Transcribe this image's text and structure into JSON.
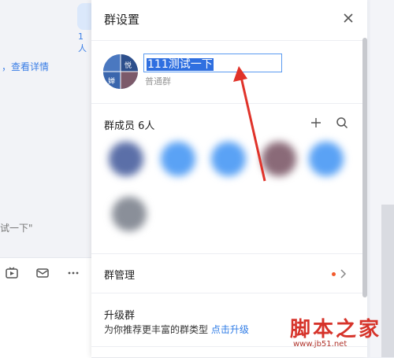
{
  "background": {
    "member_count_prefix": "1人",
    "detail_link": "，查看详情",
    "quoted_text": "试一下\""
  },
  "panel": {
    "title": "群设置",
    "group_name": "111测试一下",
    "group_type": "普通群",
    "members_label": "群成员 6人",
    "manage_label": "群管理",
    "upgrade_label": "升级群",
    "upgrade_desc": "为你推荐更丰富的群类型",
    "upgrade_link": "点击升级"
  },
  "watermark": {
    "title": "脚本之家",
    "url": "www.jb51.net"
  },
  "colors": {
    "accent": "#2e7be6",
    "selection": "#2f6fe0",
    "annotation": "#e0332a",
    "badge": "#f25a2c"
  }
}
